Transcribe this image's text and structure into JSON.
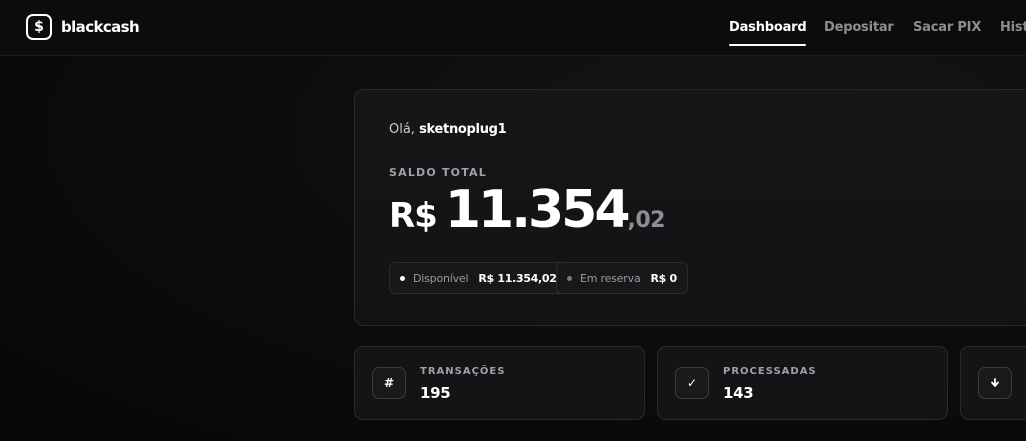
{
  "brand": {
    "logo_icon": "dollar-icon",
    "logo_glyph": "$",
    "name": "blackcash"
  },
  "nav": {
    "items": [
      {
        "label": "Dashboard",
        "active": true
      },
      {
        "label": "Depositar",
        "active": false
      },
      {
        "label": "Sacar PIX",
        "active": false
      },
      {
        "label": "Histó",
        "active": false
      }
    ]
  },
  "greeting": {
    "prefix": "Olá, ",
    "username": "sketnoplug1"
  },
  "balance": {
    "label": "SALDO TOTAL",
    "currency": "R$",
    "integer": "11.354",
    "cents": ",02",
    "available_label": "Disponível",
    "available_value": "R$ 11.354,02",
    "reserve_label": "Em reserva",
    "reserve_value": "R$ 0"
  },
  "stats": [
    {
      "icon": "hash-icon",
      "glyph": "#",
      "label": "TRANSAÇÕES",
      "value": "195"
    },
    {
      "icon": "check-icon",
      "glyph": "✓",
      "label": "PROCESSADAS",
      "value": "143"
    },
    {
      "icon": "arrow-down-icon",
      "glyph": "🡇",
      "label": "",
      "value": ""
    }
  ],
  "colors": {
    "background": "#0a0a0b",
    "card": "#161618",
    "border": "#2a2a2e",
    "text_primary": "#ffffff",
    "text_muted": "#8e8e94"
  }
}
